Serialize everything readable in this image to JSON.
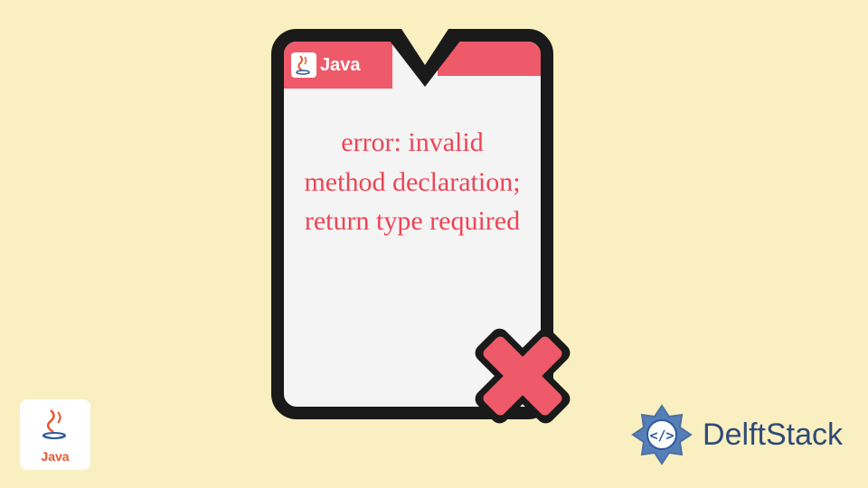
{
  "card": {
    "java_tag": "Java",
    "error_message": "error: invalid method declaration; return type required"
  },
  "corner_logo": {
    "label": "Java"
  },
  "brand": {
    "name": "DelftStack"
  },
  "colors": {
    "background": "#f9efc0",
    "accent": "#ee5a6a",
    "error_text": "#ee4455",
    "brand_blue": "#2e4a7a"
  }
}
